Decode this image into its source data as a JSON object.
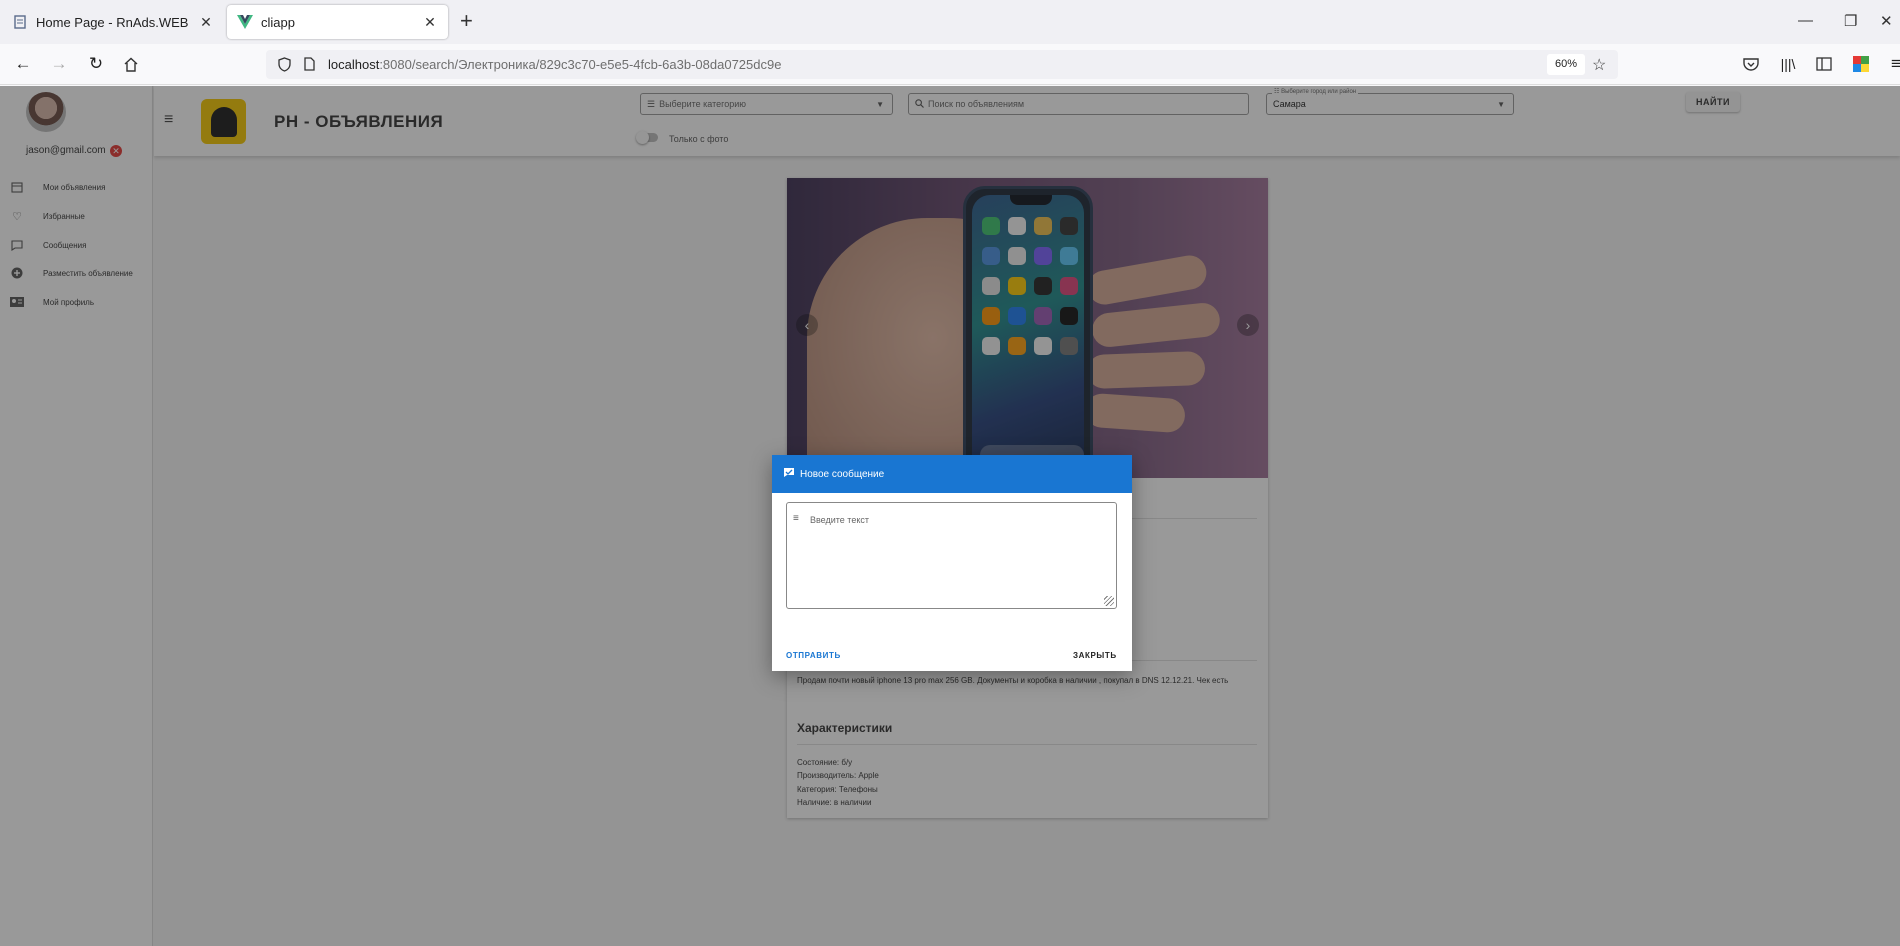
{
  "browser": {
    "tabs": [
      {
        "title": "Home Page - RnAds.WEB",
        "active": false
      },
      {
        "title": "cliapp",
        "active": true
      }
    ],
    "url_host": "localhost",
    "url_rest": ":8080/search/Электроника/829c3c70-e5e5-4fcb-6a3b-08da0725dc9e",
    "zoom": "60%"
  },
  "user": {
    "email": "jason@gmail.com"
  },
  "sidebar": {
    "items": [
      {
        "label": "Мои объявления",
        "icon": "calendar-icon"
      },
      {
        "label": "Избранные",
        "icon": "heart-icon"
      },
      {
        "label": "Сообщения",
        "icon": "message-icon"
      },
      {
        "label": "Разместить объявление",
        "icon": "plus-circle-icon"
      },
      {
        "label": "Мой профиль",
        "icon": "id-card-icon"
      }
    ]
  },
  "header": {
    "title": "РН - ОБЪЯВЛЕНИЯ",
    "category_placeholder": "Выберите категорию",
    "search_placeholder": "Поиск по объявлениям",
    "city_label": "Выберите город или район",
    "city_value": "Самара",
    "find_button": "НАЙТИ",
    "photo_only": "Только с фото"
  },
  "ad": {
    "description": "Продам почти новый iphone 13 pro max 256 GB. Документы и коробка в наличии , покупал в DNS 12.12.21. Чек есть",
    "characteristics_title": "Характеристики",
    "characteristics": [
      "Состояние: б/у",
      "Производитель: Apple",
      "Категория: Телефоны",
      "Наличие: в наличии"
    ]
  },
  "dialog": {
    "title": "Новое сообщение",
    "placeholder": "Введите текст",
    "send": "ОТПРАВИТЬ",
    "close": "ЗАКРЫТЬ"
  },
  "colors": {
    "accent": "#1976d2",
    "logo": "#f5c800",
    "error": "#e53935"
  }
}
